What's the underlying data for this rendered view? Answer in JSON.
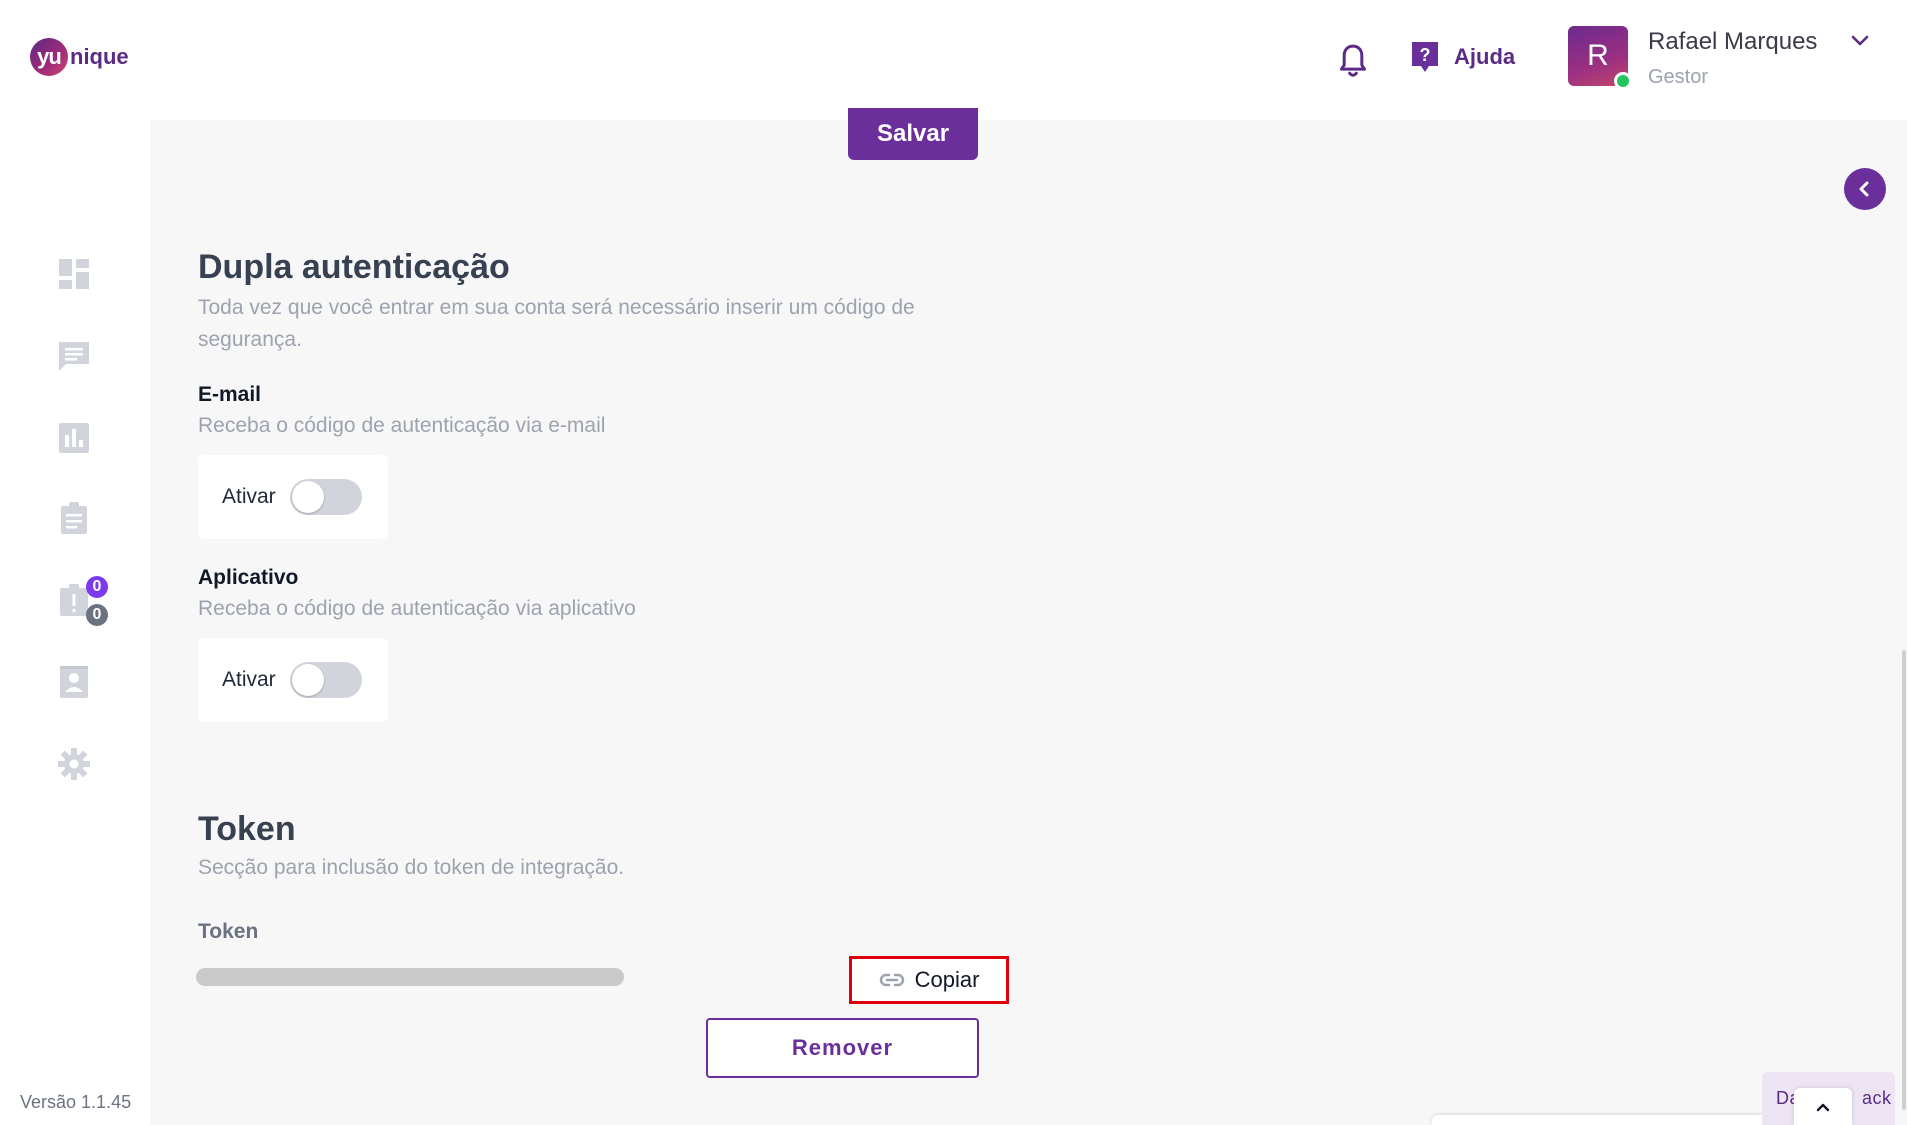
{
  "header": {
    "logo_text": "nique",
    "logo_mark": "yu",
    "help_label": "Ajuda",
    "user_name": "Rafael Marques",
    "user_role": "Gestor",
    "avatar_initial": "R"
  },
  "sidebar": {
    "items": [
      {
        "icon": "dashboard-icon"
      },
      {
        "icon": "chat-icon"
      },
      {
        "icon": "bar-chart-icon"
      },
      {
        "icon": "clipboard-icon"
      },
      {
        "icon": "alert-ticket-icon",
        "badge_top": "0",
        "badge_bottom": "0"
      },
      {
        "icon": "contact-card-icon"
      },
      {
        "icon": "gear-icon"
      }
    ],
    "version": "Versão 1.1.45"
  },
  "main": {
    "save_label": "Salvar",
    "two_factor": {
      "title": "Dupla autenticação",
      "description": "Toda vez que você entrar em sua conta será necessário inserir um código de segurança.",
      "email": {
        "label": "E-mail",
        "description": "Receba o código de autenticação via e-mail",
        "toggle_label": "Ativar",
        "enabled": false
      },
      "app": {
        "label": "Aplicativo",
        "description": "Receba o código de autenticação via aplicativo",
        "toggle_label": "Ativar",
        "enabled": false
      }
    },
    "token": {
      "title": "Token",
      "description": "Secção para inclusão do token de integração.",
      "field_label": "Token",
      "copy_label": "Copiar",
      "remove_label": "Remover"
    }
  },
  "footer": {
    "feedback_left": "Da",
    "feedback_right": "ack"
  },
  "colors": {
    "brand": "#6b2f9c",
    "highlight": "#e0000c",
    "online": "#22c55e"
  }
}
